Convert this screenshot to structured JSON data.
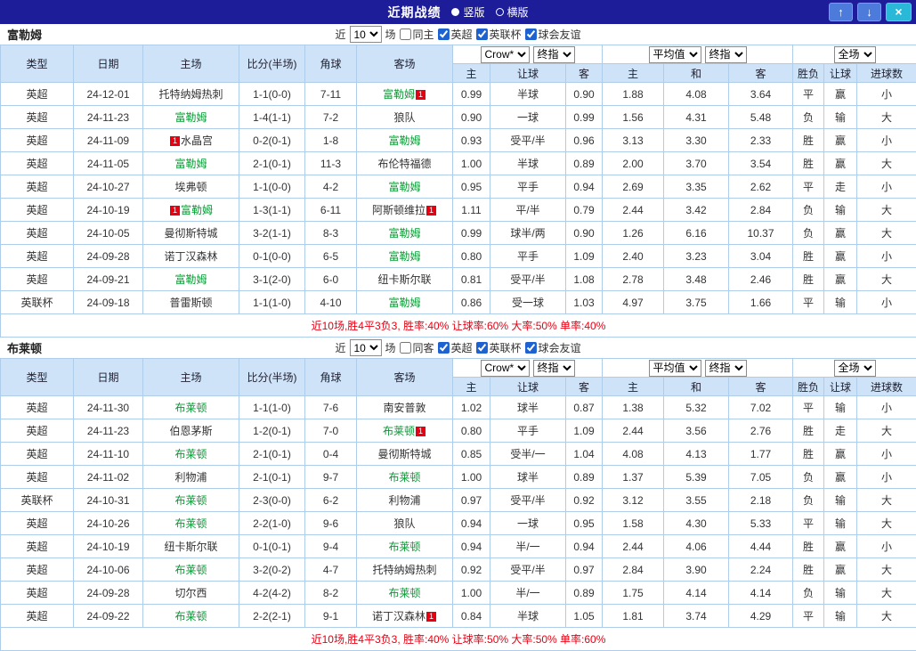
{
  "topbar": {
    "title": "近期战绩",
    "vertical_label": "竖版",
    "horizontal_label": "横版",
    "up_icon": "↑",
    "down_icon": "↓",
    "close_icon": "×"
  },
  "table_headers": {
    "type": "类型",
    "date": "日期",
    "home": "主场",
    "score": "比分(半场)",
    "corner": "角球",
    "away": "客场",
    "asia_home": "主",
    "asia_handicap": "让球",
    "asia_away": "客",
    "euro_home": "主",
    "euro_draw": "和",
    "euro_away": "客",
    "result": "胜负",
    "cover": "让球",
    "goals": "进球数"
  },
  "sections": [
    {
      "team": "富勒姆",
      "filters": {
        "near_label": "近",
        "count": "10",
        "games_label": "场",
        "same_label": "同主",
        "same_checked": false,
        "leagues": [
          {
            "label": "英超",
            "checked": true
          },
          {
            "label": "英联杯",
            "checked": true
          },
          {
            "label": "球会友谊",
            "checked": true
          }
        ]
      },
      "selects": {
        "company": "Crow*",
        "company_time": "终指",
        "euro": "平均值",
        "euro_time": "终指",
        "scope": "全场"
      },
      "rows": [
        {
          "type": "英超",
          "league_style": "epl",
          "date": "24-12-01",
          "home": {
            "name": "托特纳姆热刺",
            "focus": false
          },
          "score": "1-1(0-0)",
          "corner": "7-11",
          "away": {
            "name": "富勒姆",
            "focus": true,
            "badge": "after"
          },
          "asia_home": "0.99",
          "handicap": "半球",
          "asia_away": "0.90",
          "euro_home": "1.88",
          "euro_draw": "4.08",
          "euro_away": "3.64",
          "result": "平",
          "cover": "赢",
          "goals": "小"
        },
        {
          "type": "英超",
          "league_style": "epl",
          "date": "24-11-23",
          "home": {
            "name": "富勒姆",
            "focus": true
          },
          "score": "1-4(1-1)",
          "corner": "7-2",
          "away": {
            "name": "狼队",
            "focus": false
          },
          "asia_home": "0.90",
          "handicap": "一球",
          "asia_away": "0.99",
          "euro_home": "1.56",
          "euro_draw": "4.31",
          "euro_away": "5.48",
          "result": "负",
          "cover": "输",
          "goals": "大"
        },
        {
          "type": "英超",
          "league_style": "epl",
          "date": "24-11-09",
          "home": {
            "name": "水晶宫",
            "focus": false,
            "badge": "before"
          },
          "score": "0-2(0-1)",
          "corner": "1-8",
          "away": {
            "name": "富勒姆",
            "focus": true
          },
          "asia_home": "0.93",
          "handicap": "受平/半",
          "asia_away": "0.96",
          "euro_home": "3.13",
          "euro_draw": "3.30",
          "euro_away": "2.33",
          "result": "胜",
          "cover": "赢",
          "goals": "小"
        },
        {
          "type": "英超",
          "league_style": "epl",
          "date": "24-11-05",
          "home": {
            "name": "富勒姆",
            "focus": true
          },
          "score": "2-1(0-1)",
          "corner": "11-3",
          "away": {
            "name": "布伦特福德",
            "focus": false
          },
          "asia_home": "1.00",
          "handicap": "半球",
          "asia_away": "0.89",
          "euro_home": "2.00",
          "euro_draw": "3.70",
          "euro_away": "3.54",
          "result": "胜",
          "cover": "赢",
          "goals": "大"
        },
        {
          "type": "英超",
          "league_style": "epl",
          "date": "24-10-27",
          "home": {
            "name": "埃弗顿",
            "focus": false
          },
          "score": "1-1(0-0)",
          "corner": "4-2",
          "away": {
            "name": "富勒姆",
            "focus": true
          },
          "asia_home": "0.95",
          "handicap": "平手",
          "asia_away": "0.94",
          "euro_home": "2.69",
          "euro_draw": "3.35",
          "euro_away": "2.62",
          "result": "平",
          "cover": "走",
          "goals": "小"
        },
        {
          "type": "英超",
          "league_style": "epl",
          "date": "24-10-19",
          "home": {
            "name": "富勒姆",
            "focus": true,
            "badge": "before"
          },
          "score": "1-3(1-1)",
          "corner": "6-11",
          "away": {
            "name": "阿斯顿维拉",
            "focus": false,
            "badge": "after"
          },
          "asia_home": "1.11",
          "handicap": "平/半",
          "asia_away": "0.79",
          "euro_home": "2.44",
          "euro_draw": "3.42",
          "euro_away": "2.84",
          "result": "负",
          "cover": "输",
          "goals": "大"
        },
        {
          "type": "英超",
          "league_style": "epl",
          "date": "24-10-05",
          "home": {
            "name": "曼彻斯特城",
            "focus": false
          },
          "score": "3-2(1-1)",
          "corner": "8-3",
          "away": {
            "name": "富勒姆",
            "focus": true
          },
          "asia_home": "0.99",
          "handicap": "球半/两",
          "asia_away": "0.90",
          "euro_home": "1.26",
          "euro_draw": "6.16",
          "euro_away": "10.37",
          "result": "负",
          "cover": "赢",
          "goals": "大"
        },
        {
          "type": "英超",
          "league_style": "epl",
          "date": "24-09-28",
          "home": {
            "name": "诺丁汉森林",
            "focus": false
          },
          "score": "0-1(0-0)",
          "corner": "6-5",
          "away": {
            "name": "富勒姆",
            "focus": true
          },
          "asia_home": "0.80",
          "handicap": "平手",
          "asia_away": "1.09",
          "euro_home": "2.40",
          "euro_draw": "3.23",
          "euro_away": "3.04",
          "result": "胜",
          "cover": "赢",
          "goals": "小"
        },
        {
          "type": "英超",
          "league_style": "epl",
          "date": "24-09-21",
          "home": {
            "name": "富勒姆",
            "focus": true
          },
          "score": "3-1(2-0)",
          "corner": "6-0",
          "away": {
            "name": "纽卡斯尔联",
            "focus": false
          },
          "asia_home": "0.81",
          "handicap": "受平/半",
          "asia_away": "1.08",
          "euro_home": "2.78",
          "euro_draw": "3.48",
          "euro_away": "2.46",
          "result": "胜",
          "cover": "赢",
          "goals": "大"
        },
        {
          "type": "英联杯",
          "league_style": "cup",
          "date": "24-09-18",
          "home": {
            "name": "普雷斯顿",
            "focus": false
          },
          "score": "1-1(1-0)",
          "corner": "4-10",
          "away": {
            "name": "富勒姆",
            "focus": true
          },
          "asia_home": "0.86",
          "handicap": "受一球",
          "asia_away": "1.03",
          "euro_home": "4.97",
          "euro_draw": "3.75",
          "euro_away": "1.66",
          "result": "平",
          "cover": "输",
          "goals": "小"
        }
      ],
      "summary": "近10场,胜4平3负3, 胜率:40% 让球率:60% 大率:50% 单率:40%"
    },
    {
      "team": "布莱顿",
      "filters": {
        "near_label": "近",
        "count": "10",
        "games_label": "场",
        "same_label": "同客",
        "same_checked": false,
        "leagues": [
          {
            "label": "英超",
            "checked": true
          },
          {
            "label": "英联杯",
            "checked": true
          },
          {
            "label": "球会友谊",
            "checked": true
          }
        ]
      },
      "selects": {
        "company": "Crow*",
        "company_time": "终指",
        "euro": "平均值",
        "euro_time": "终指",
        "scope": "全场"
      },
      "rows": [
        {
          "type": "英超",
          "league_style": "epl",
          "date": "24-11-30",
          "home": {
            "name": "布莱顿",
            "focus": true
          },
          "score": "1-1(1-0)",
          "corner": "7-6",
          "away": {
            "name": "南安普敦",
            "focus": false
          },
          "asia_home": "1.02",
          "handicap": "球半",
          "asia_away": "0.87",
          "euro_home": "1.38",
          "euro_draw": "5.32",
          "euro_away": "7.02",
          "result": "平",
          "cover": "输",
          "goals": "小"
        },
        {
          "type": "英超",
          "league_style": "epl",
          "date": "24-11-23",
          "home": {
            "name": "伯恩茅斯",
            "focus": false
          },
          "score": "1-2(0-1)",
          "corner": "7-0",
          "away": {
            "name": "布莱顿",
            "focus": true,
            "badge": "after"
          },
          "asia_home": "0.80",
          "handicap": "平手",
          "asia_away": "1.09",
          "euro_home": "2.44",
          "euro_draw": "3.56",
          "euro_away": "2.76",
          "result": "胜",
          "cover": "走",
          "goals": "大"
        },
        {
          "type": "英超",
          "league_style": "epl",
          "date": "24-11-10",
          "home": {
            "name": "布莱顿",
            "focus": true
          },
          "score": "2-1(0-1)",
          "corner": "0-4",
          "away": {
            "name": "曼彻斯特城",
            "focus": false
          },
          "asia_home": "0.85",
          "handicap": "受半/一",
          "asia_away": "1.04",
          "euro_home": "4.08",
          "euro_draw": "4.13",
          "euro_away": "1.77",
          "result": "胜",
          "cover": "赢",
          "goals": "小"
        },
        {
          "type": "英超",
          "league_style": "epl",
          "date": "24-11-02",
          "home": {
            "name": "利物浦",
            "focus": false
          },
          "score": "2-1(0-1)",
          "corner": "9-7",
          "away": {
            "name": "布莱顿",
            "focus": true
          },
          "asia_home": "1.00",
          "handicap": "球半",
          "asia_away": "0.89",
          "euro_home": "1.37",
          "euro_draw": "5.39",
          "euro_away": "7.05",
          "result": "负",
          "cover": "赢",
          "goals": "小"
        },
        {
          "type": "英联杯",
          "league_style": "cup",
          "date": "24-10-31",
          "home": {
            "name": "布莱顿",
            "focus": true
          },
          "score": "2-3(0-0)",
          "corner": "6-2",
          "away": {
            "name": "利物浦",
            "focus": false
          },
          "asia_home": "0.97",
          "handicap": "受平/半",
          "asia_away": "0.92",
          "euro_home": "3.12",
          "euro_draw": "3.55",
          "euro_away": "2.18",
          "result": "负",
          "cover": "输",
          "goals": "大"
        },
        {
          "type": "英超",
          "league_style": "epl",
          "date": "24-10-26",
          "home": {
            "name": "布莱顿",
            "focus": true
          },
          "score": "2-2(1-0)",
          "corner": "9-6",
          "away": {
            "name": "狼队",
            "focus": false
          },
          "asia_home": "0.94",
          "handicap": "一球",
          "asia_away": "0.95",
          "euro_home": "1.58",
          "euro_draw": "4.30",
          "euro_away": "5.33",
          "result": "平",
          "cover": "输",
          "goals": "大"
        },
        {
          "type": "英超",
          "league_style": "epl",
          "date": "24-10-19",
          "home": {
            "name": "纽卡斯尔联",
            "focus": false
          },
          "score": "0-1(0-1)",
          "corner": "9-4",
          "away": {
            "name": "布莱顿",
            "focus": true
          },
          "asia_home": "0.94",
          "handicap": "半/一",
          "asia_away": "0.94",
          "euro_home": "2.44",
          "euro_draw": "4.06",
          "euro_away": "4.44",
          "result": "胜",
          "cover": "赢",
          "goals": "小"
        },
        {
          "type": "英超",
          "league_style": "epl",
          "date": "24-10-06",
          "home": {
            "name": "布莱顿",
            "focus": true
          },
          "score": "3-2(0-2)",
          "corner": "4-7",
          "away": {
            "name": "托特纳姆热刺",
            "focus": false
          },
          "asia_home": "0.92",
          "handicap": "受平/半",
          "asia_away": "0.97",
          "euro_home": "2.84",
          "euro_draw": "3.90",
          "euro_away": "2.24",
          "result": "胜",
          "cover": "赢",
          "goals": "大"
        },
        {
          "type": "英超",
          "league_style": "epl",
          "date": "24-09-28",
          "home": {
            "name": "切尔西",
            "focus": false
          },
          "score": "4-2(4-2)",
          "corner": "8-2",
          "away": {
            "name": "布莱顿",
            "focus": true
          },
          "asia_home": "1.00",
          "handicap": "半/一",
          "asia_away": "0.89",
          "euro_home": "1.75",
          "euro_draw": "4.14",
          "euro_away": "4.14",
          "result": "负",
          "cover": "输",
          "goals": "大"
        },
        {
          "type": "英超",
          "league_style": "epl",
          "date": "24-09-22",
          "home": {
            "name": "布莱顿",
            "focus": true
          },
          "score": "2-2(2-1)",
          "corner": "9-1",
          "away": {
            "name": "诺丁汉森林",
            "focus": false,
            "badge": "after"
          },
          "asia_home": "0.84",
          "handicap": "半球",
          "asia_away": "1.05",
          "euro_home": "1.81",
          "euro_draw": "3.74",
          "euro_away": "4.29",
          "result": "平",
          "cover": "输",
          "goals": "大"
        }
      ],
      "summary": "近10场,胜4平3负3, 胜率:40% 让球率:50% 大率:50% 单率:60%"
    }
  ]
}
